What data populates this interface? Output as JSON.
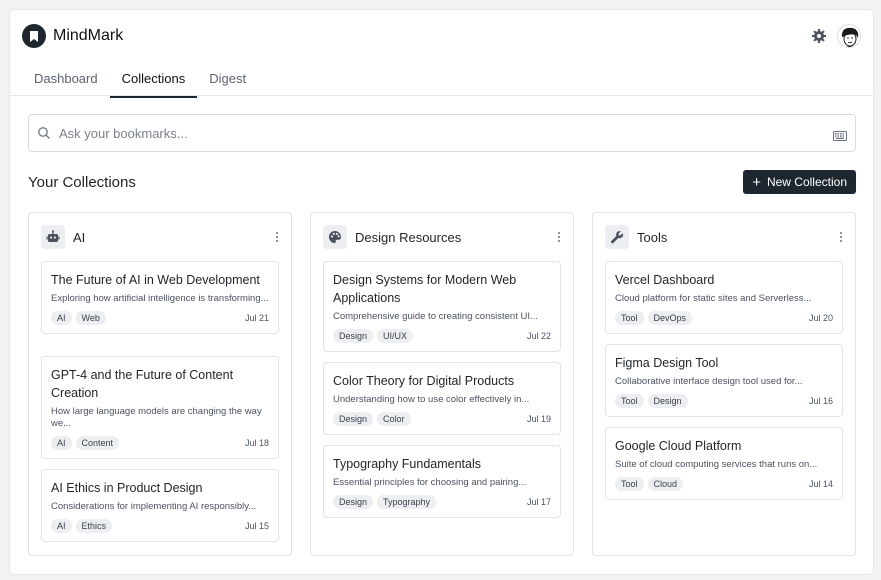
{
  "app": {
    "name": "MindMark"
  },
  "tabs": [
    {
      "label": "Dashboard"
    },
    {
      "label": "Collections"
    },
    {
      "label": "Digest"
    }
  ],
  "search": {
    "placeholder": "Ask your bookmarks..."
  },
  "section": {
    "title": "Your Collections",
    "new_button": "New Collection"
  },
  "collections": [
    {
      "title": "AI",
      "icon": "robot-icon",
      "cards": [
        {
          "title": "The Future of AI in Web Development",
          "desc": "Exploring how artificial intelligence is transforming...",
          "tags": [
            "AI",
            "Web"
          ],
          "date": "Jul 21"
        },
        {
          "title": "GPT-4 and the Future of Content Creation",
          "desc": "How large language models are changing the way we...",
          "tags": [
            "AI",
            "Content"
          ],
          "date": "Jul 18"
        },
        {
          "title": "AI Ethics in Product Design",
          "desc": "Considerations for implementing AI responsibly...",
          "tags": [
            "AI",
            "Ethics"
          ],
          "date": "Jul 15"
        }
      ]
    },
    {
      "title": "Design Resources",
      "icon": "palette-icon",
      "cards": [
        {
          "title": "Design Systems for Modern Web Applications",
          "desc": "Comprehensive guide to creating consistent UI...",
          "tags": [
            "Design",
            "UI/UX"
          ],
          "date": "Jul 22"
        },
        {
          "title": "Color Theory for Digital Products",
          "desc": "Understanding how to use color effectively in...",
          "tags": [
            "Design",
            "Color"
          ],
          "date": "Jul 19"
        },
        {
          "title": "Typography Fundamentals",
          "desc": "Essential principles for choosing and pairing...",
          "tags": [
            "Design",
            "Typography"
          ],
          "date": "Jul 17"
        }
      ]
    },
    {
      "title": "Tools",
      "icon": "wrench-icon",
      "cards": [
        {
          "title": "Vercel Dashboard",
          "desc": "Cloud platform for static sites and Serverless...",
          "tags": [
            "Tool",
            "DevOps"
          ],
          "date": "Jul 20"
        },
        {
          "title": "Figma Design Tool",
          "desc": "Collaborative interface design tool used for...",
          "tags": [
            "Tool",
            "Design"
          ],
          "date": "Jul 16"
        },
        {
          "title": "Google Cloud Platform",
          "desc": "Suite of cloud computing services that runs on...",
          "tags": [
            "Tool",
            "Cloud"
          ],
          "date": "Jul 14"
        }
      ]
    }
  ]
}
